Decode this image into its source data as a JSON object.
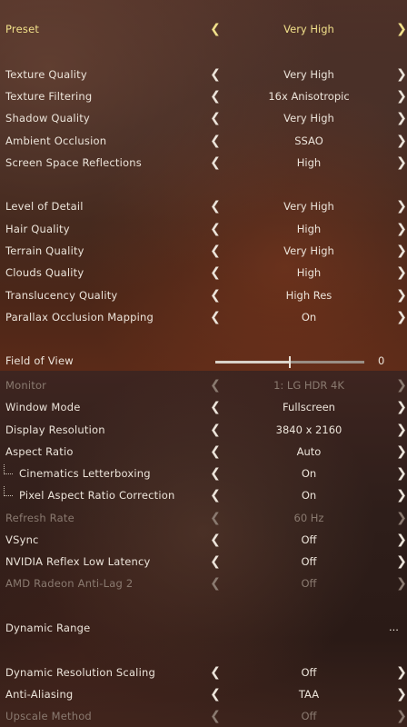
{
  "preset": {
    "label": "Preset",
    "value": "Very High"
  },
  "graphics": [
    {
      "label": "Texture Quality",
      "value": "Very High"
    },
    {
      "label": "Texture Filtering",
      "value": "16x Anisotropic"
    },
    {
      "label": "Shadow Quality",
      "value": "Very High"
    },
    {
      "label": "Ambient Occlusion",
      "value": "SSAO"
    },
    {
      "label": "Screen Space Reflections",
      "value": "High"
    }
  ],
  "detail": [
    {
      "label": "Level of Detail",
      "value": "Very High"
    },
    {
      "label": "Hair Quality",
      "value": "High"
    },
    {
      "label": "Terrain Quality",
      "value": "Very High"
    },
    {
      "label": "Clouds Quality",
      "value": "High"
    },
    {
      "label": "Translucency Quality",
      "value": "High Res"
    },
    {
      "label": "Parallax Occlusion Mapping",
      "value": "On"
    }
  ],
  "fov": {
    "label": "Field of View",
    "value": "0",
    "level": 0.5
  },
  "display": [
    {
      "label": "Monitor",
      "value": "1: LG HDR 4K",
      "disabled": true
    },
    {
      "label": "Window Mode",
      "value": "Fullscreen"
    },
    {
      "label": "Display Resolution",
      "value": "3840 x 2160"
    },
    {
      "label": "Aspect Ratio",
      "value": "Auto"
    },
    {
      "label": "Cinematics Letterboxing",
      "value": "On",
      "sub": true
    },
    {
      "label": "Pixel Aspect Ratio Correction",
      "value": "On",
      "sub": true
    },
    {
      "label": "Refresh Rate",
      "value": "60 Hz",
      "disabled": true
    },
    {
      "label": "VSync",
      "value": "Off"
    },
    {
      "label": "NVIDIA Reflex Low Latency",
      "value": "Off"
    },
    {
      "label": "AMD Radeon Anti-Lag 2",
      "value": "Off",
      "disabled": true
    }
  ],
  "dynamic_range": {
    "label": "Dynamic Range",
    "value": "..."
  },
  "upscaling": [
    {
      "label": "Dynamic Resolution Scaling",
      "value": "Off"
    },
    {
      "label": "Anti-Aliasing",
      "value": "TAA"
    },
    {
      "label": "Upscale Method",
      "value": "Off",
      "disabled": true
    }
  ],
  "icons": {
    "left": "chevron-left-icon",
    "right": "chevron-right-icon"
  },
  "colors": {
    "highlight": "#f1e08a",
    "disabled": "#8a7a70",
    "text": "#ece4da"
  }
}
